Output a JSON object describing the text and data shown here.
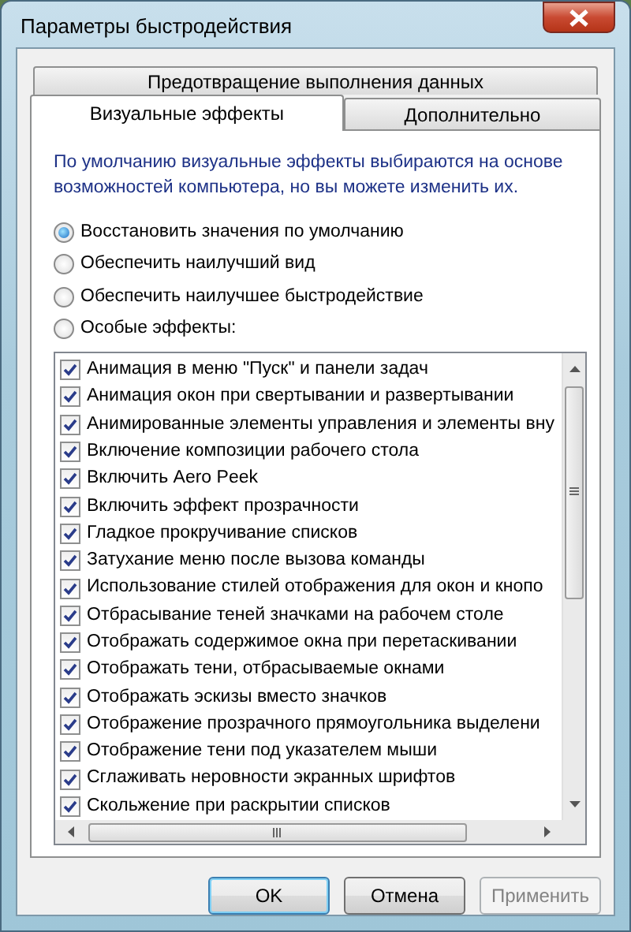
{
  "window": {
    "title": "Параметры быстродействия"
  },
  "tab_rows": [
    [
      {
        "label": "Предотвращение выполнения данных",
        "selected": false
      }
    ],
    [
      {
        "label": "Визуальные эффекты",
        "selected": true
      },
      {
        "label": "Дополнительно",
        "selected": false
      }
    ]
  ],
  "description": "По умолчанию визуальные эффекты выбираются на основе возможностей компьютера, но вы можете изменить их.",
  "options": [
    {
      "label": "Восстановить значения по умолчанию",
      "selected": true
    },
    {
      "label": "Обеспечить наилучший вид",
      "selected": false
    },
    {
      "label": "Обеспечить наилучшее быстродействие",
      "selected": false
    },
    {
      "label": "Особые эффекты:",
      "selected": false
    }
  ],
  "effects": [
    {
      "label": "Анимация в меню \"Пуск\" и панели задач",
      "checked": true
    },
    {
      "label": "Анимация окон при свертывании и развертывании",
      "checked": true
    },
    {
      "label": "Анимированные элементы управления и элементы вну",
      "checked": true
    },
    {
      "label": "Включение композиции рабочего стола",
      "checked": true
    },
    {
      "label": "Включить Aero Peek",
      "checked": true
    },
    {
      "label": "Включить эффект прозрачности",
      "checked": true
    },
    {
      "label": "Гладкое прокручивание списков",
      "checked": true
    },
    {
      "label": "Затухание меню после вызова команды",
      "checked": true
    },
    {
      "label": "Использование стилей отображения для окон и кнопо",
      "checked": true
    },
    {
      "label": "Отбрасывание теней значками на рабочем столе",
      "checked": true
    },
    {
      "label": "Отображать содержимое окна при перетаскивании",
      "checked": true
    },
    {
      "label": "Отображать тени, отбрасываемые окнами",
      "checked": true
    },
    {
      "label": "Отображать эскизы вместо значков",
      "checked": true
    },
    {
      "label": "Отображение прозрачного прямоугольника выделени",
      "checked": true
    },
    {
      "label": "Отображение тени под указателем мыши",
      "checked": true
    },
    {
      "label": "Сглаживать неровности экранных шрифтов",
      "checked": true
    },
    {
      "label": "Скольжение при раскрытии списков",
      "checked": true
    }
  ],
  "buttons": [
    {
      "label": "OK",
      "disabled": false,
      "default": true
    },
    {
      "label": "Отмена",
      "disabled": false,
      "default": false
    },
    {
      "label": "Применить",
      "disabled": true,
      "default": false
    }
  ]
}
